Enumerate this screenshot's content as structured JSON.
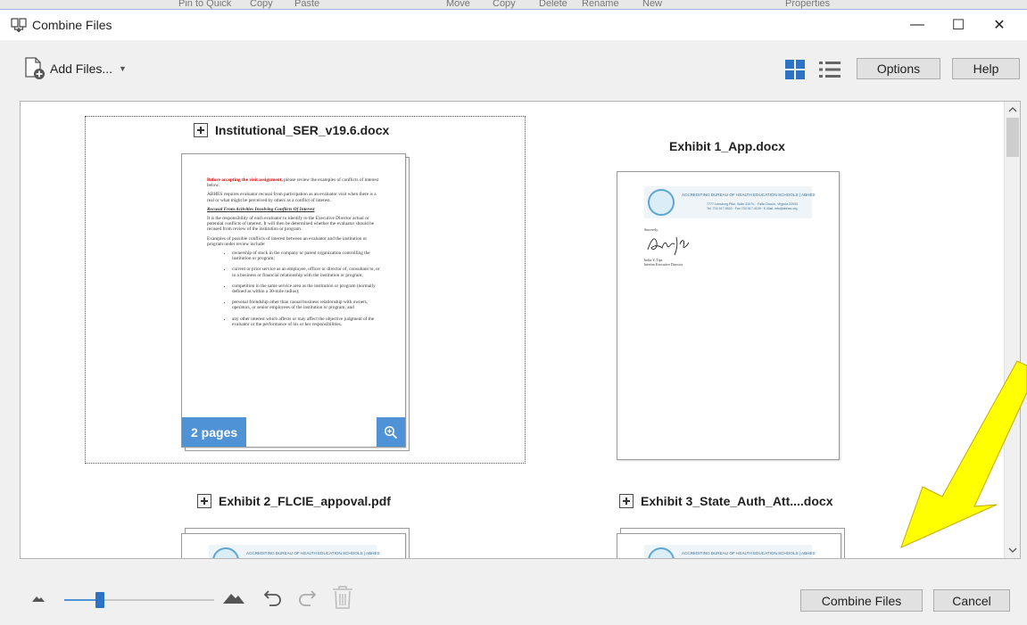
{
  "background": {
    "items": [
      "Pin to Quick",
      "Copy",
      "Paste",
      "Move",
      "Copy",
      "Delete",
      "Rename",
      "New",
      "Properties"
    ]
  },
  "window": {
    "title": "Combine Files",
    "minimize_symbol": "—",
    "maximize_symbol": "☐",
    "close_symbol": "✕"
  },
  "toolbar": {
    "add_files_label": "Add Files...",
    "add_files_caret": "▼",
    "options_label": "Options",
    "help_label": "Help",
    "accent_color": "#2d73c4"
  },
  "files": [
    {
      "name": "Institutional_SER_v19.6.docx",
      "pages_label": "2 pages",
      "selected": true,
      "preview": {
        "heading_red": "Before accepting the visit assignment,",
        "heading_rest": " please review the examples of conflicts of interest below.",
        "para1": "ABHES requires evaluator recusal from participation as an evaluator visit when there is a real or what might be perceived by others as a conflict of interest.",
        "section_title": "Recusal From Activities Involving Conflicts Of Interest",
        "para2": "It is the responsibility of each evaluator to identify to the Executive Director actual or potential conflicts of interest. It will then be determined whether the evaluator should be recused from review of the institution or program.",
        "para3": "Examples of possible conflicts of interest between an evaluator and the institution or program under review include:",
        "bullets": [
          "ownership of stock in the company or parent organization controlling the institution or program;",
          "current or prior service as an employee, officer or director of, consultant to, or in a business or financial relationship with the institution or program;",
          "competition in the same service area as the institution or program (normally defined as within a 30-mile radius);",
          "personal friendship other than casual business relationship with owners, operators, or senior employees of the institution or program; and",
          "any other interest which affects or may affect the objective judgment of the evaluator or the performance of his or her responsibilities."
        ]
      }
    },
    {
      "name": "Exhibit 1_App.docx",
      "preview": {
        "org": "ACCREDITING BUREAU OF HEALTH EDUCATION SCHOOLS | ABHES",
        "address": "7777 Leesburg Pike, Suite 314 N. · Falls Church, Virginia 22043",
        "contact": "Tel. 703.917.9503 · Fax 703.917.4109 · E-Mail: info@abhes.org",
        "closing": "Sincerely,",
        "signature": "Julie C. Tyer",
        "signer_name": "India Y. Tips",
        "signer_title": "Interim Executive Director"
      }
    },
    {
      "name": "Exhibit 2_FLCIE_appoval.pdf",
      "preview": {
        "org": "ACCREDITING BUREAU OF HEALTH EDUCATION SCHOOLS | ABHES"
      }
    },
    {
      "name": "Exhibit 3_State_Auth_Att....docx",
      "preview": {
        "org": "ACCREDITING BUREAU OF HEALTH EDUCATION SCHOOLS | ABHES"
      }
    }
  ],
  "footer": {
    "zoom_level": 0.21,
    "combine_label": "Combine Files",
    "cancel_label": "Cancel"
  },
  "annotation": {
    "arrow_color": "#ffff00",
    "arrow_outline": "#c8a800"
  }
}
